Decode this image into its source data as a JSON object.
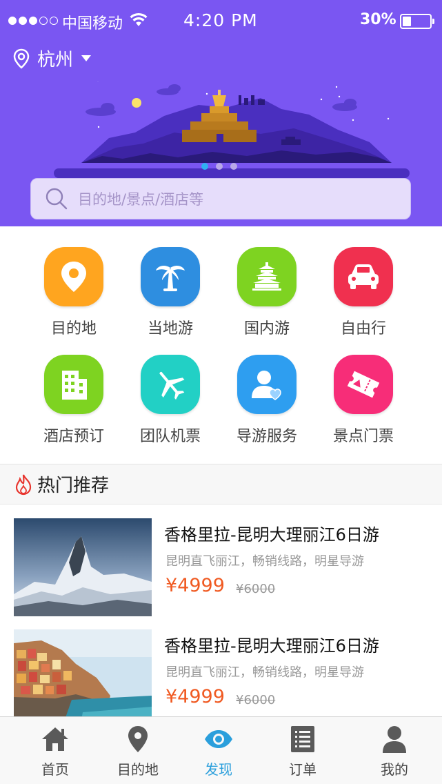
{
  "status_bar": {
    "carrier": "中国移动",
    "time": "4:20 PM",
    "battery": "30%",
    "signal_bars": 3
  },
  "location": {
    "city": "杭州"
  },
  "banner": {
    "slides": 3,
    "active_slide": 0
  },
  "search": {
    "placeholder": "目的地/景点/酒店等"
  },
  "categories": [
    {
      "label": "目的地",
      "icon": "location-pin-icon",
      "color": "#ffa51f"
    },
    {
      "label": "当地游",
      "icon": "palm-tree-icon",
      "color": "#2e8ee0"
    },
    {
      "label": "国内游",
      "icon": "temple-icon",
      "color": "#7ed321"
    },
    {
      "label": "自由行",
      "icon": "car-icon",
      "color": "#f0304f"
    },
    {
      "label": "酒店预订",
      "icon": "hotel-building-icon",
      "color": "#7ed321"
    },
    {
      "label": "团队机票",
      "icon": "airplane-icon",
      "color": "#22d0c5"
    },
    {
      "label": "导游服务",
      "icon": "guide-person-icon",
      "color": "#2e9ef0"
    },
    {
      "label": "景点门票",
      "icon": "ticket-icon",
      "color": "#f72d78"
    }
  ],
  "section": {
    "title": "热门推荐"
  },
  "products": [
    {
      "title": "香格里拉-昆明大理丽江6日游",
      "subtitle": "昆明直飞丽江，畅销线路，明星导游",
      "price": "¥4999",
      "original_price": "¥6000",
      "image": "snowy-mountain"
    },
    {
      "title": "香格里拉-昆明大理丽江6日游",
      "subtitle": "昆明直飞丽江，畅销线路，明星导游",
      "price": "¥4999",
      "original_price": "¥6000",
      "image": "coastal-village"
    }
  ],
  "tabs": [
    {
      "label": "首页",
      "icon": "home-icon",
      "active": false
    },
    {
      "label": "目的地",
      "icon": "location-pin-icon",
      "active": false
    },
    {
      "label": "发现",
      "icon": "eye-icon",
      "active": true
    },
    {
      "label": "订单",
      "icon": "list-icon",
      "active": false
    },
    {
      "label": "我的",
      "icon": "user-icon",
      "active": false
    }
  ],
  "colors": {
    "header": "#7a56f2",
    "price": "#f05a22",
    "active_tab": "#2b9fdc"
  }
}
